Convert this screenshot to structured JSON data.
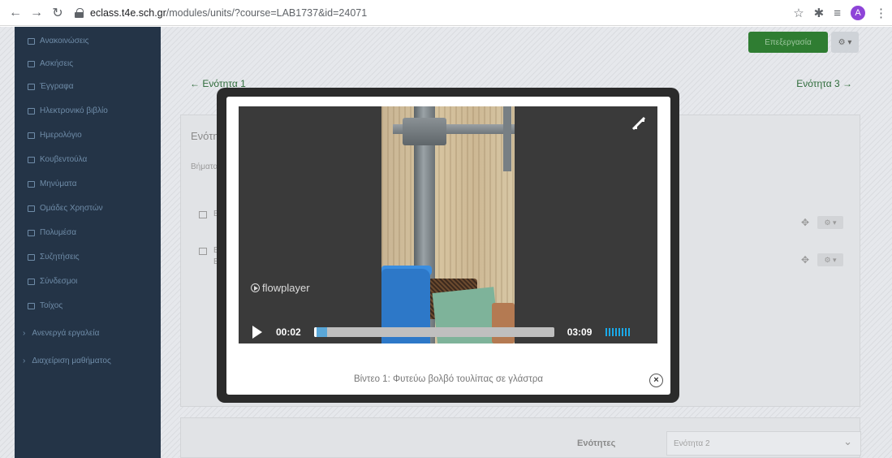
{
  "browser": {
    "url_host": "eclass.t4e.sch.gr",
    "url_path": "/modules/units/?course=LAB1737&id=24071",
    "avatar_letter": "A"
  },
  "sidebar": {
    "items": [
      "Ανακοινώσεις",
      "Ασκήσεις",
      "Έγγραφα",
      "Ηλεκτρονικό βιβλίο",
      "Ημερολόγιο",
      "Κουβεντούλα",
      "Μηνύματα",
      "Ομάδες Χρηστών",
      "Πολυμέσα",
      "Συζητήσεις",
      "Σύνδεσμοι",
      "Τοίχος"
    ],
    "sections": [
      "Ανενεργά εργαλεία",
      "Διαχείριση μαθήματος"
    ]
  },
  "content": {
    "tools_button": "Επεξεργασία",
    "prev_unit": "← Ενότητα 1",
    "next_unit": "Ενότητα 3 →",
    "panel_title": "Ενότητ",
    "panel_subtitle": "Βήματα",
    "row1": "Bl",
    "row2": "Bl",
    "row2b": "Ei",
    "units_label": "Ενότητες",
    "units_selected": "Ενότητα 2"
  },
  "video": {
    "brand": "flowplayer",
    "elapsed": "00:02",
    "duration": "03:09",
    "progress_fraction": 0.0106,
    "caption": "Βίντεο 1: Φυτεύω βολβό τουλίπας σε γλάστρα"
  },
  "colors": {
    "accent_green": "#2f7d32",
    "sidebar_bg": "#243447",
    "volume_blue": "#1aa9e8"
  },
  "icons": [
    "back-icon",
    "forward-icon",
    "reload-icon",
    "lock-icon",
    "star-icon",
    "puzzle-icon",
    "playlist-icon",
    "menu-icon",
    "fullscreen-icon",
    "play-icon",
    "close-icon"
  ]
}
